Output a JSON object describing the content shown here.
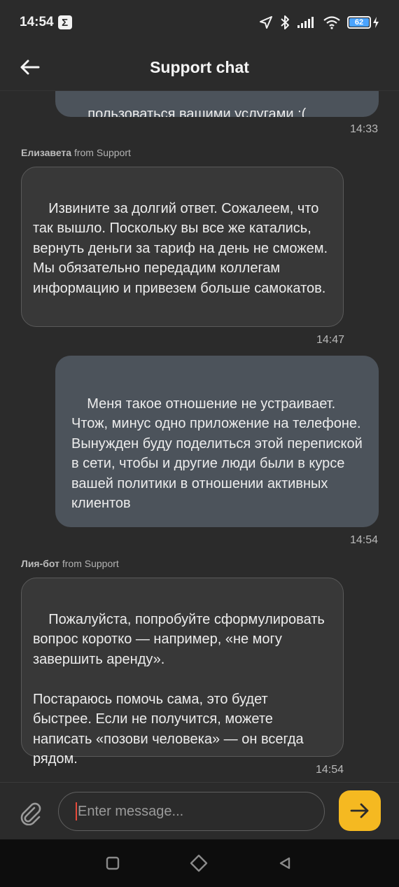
{
  "status": {
    "time": "14:54",
    "sigma": "Σ",
    "battery": "62"
  },
  "header": {
    "title": "Support chat"
  },
  "messages": {
    "m0": {
      "text": "пользоваться вашими услугами :(",
      "time": "14:33"
    },
    "m1": {
      "sender_name": "Елизавета",
      "sender_suffix": "from Support",
      "text": "Извините за долгий ответ. Сожалеем, что так вышло. Поскольку вы все же катались, вернуть деньги за тариф на день не сможем.\nМы обязательно передадим коллегам информацию и привезем больше самокатов.",
      "time": "14:47"
    },
    "m2": {
      "text": "Меня такое отношение не устраивает. Чтож, минус одно приложение на телефоне.\nВынужден буду поделиться этой перепиской в сети, чтобы и другие люди были в курсе вашей политики в отношении активных клиентов",
      "time": "14:54"
    },
    "m3": {
      "sender_name": "Лия-бот",
      "sender_suffix": "from Support",
      "text": "Пожалуйста, попробуйте сформулировать вопрос коротко — например, «не могу завершить аренду».\n\nПостараюсь помочь сама, это будет быстрее. Если не получится, можете написать «позови человека» — он всегда рядом.",
      "time": "14:54"
    }
  },
  "composer": {
    "placeholder": "Enter message...",
    "value": ""
  },
  "colors": {
    "background": "#2b2b2b",
    "outgoing_bubble": "#4c535b",
    "incoming_bubble": "#383838",
    "send_button": "#f5b921",
    "caret": "#e64a3b",
    "battery": "#4aa3ff"
  },
  "icons": {
    "back": "arrow-left-icon",
    "attach": "paperclip-icon",
    "send": "arrow-right-icon",
    "nav_recents": "square-icon",
    "nav_home": "diamond-icon",
    "nav_back": "triangle-left-icon"
  }
}
